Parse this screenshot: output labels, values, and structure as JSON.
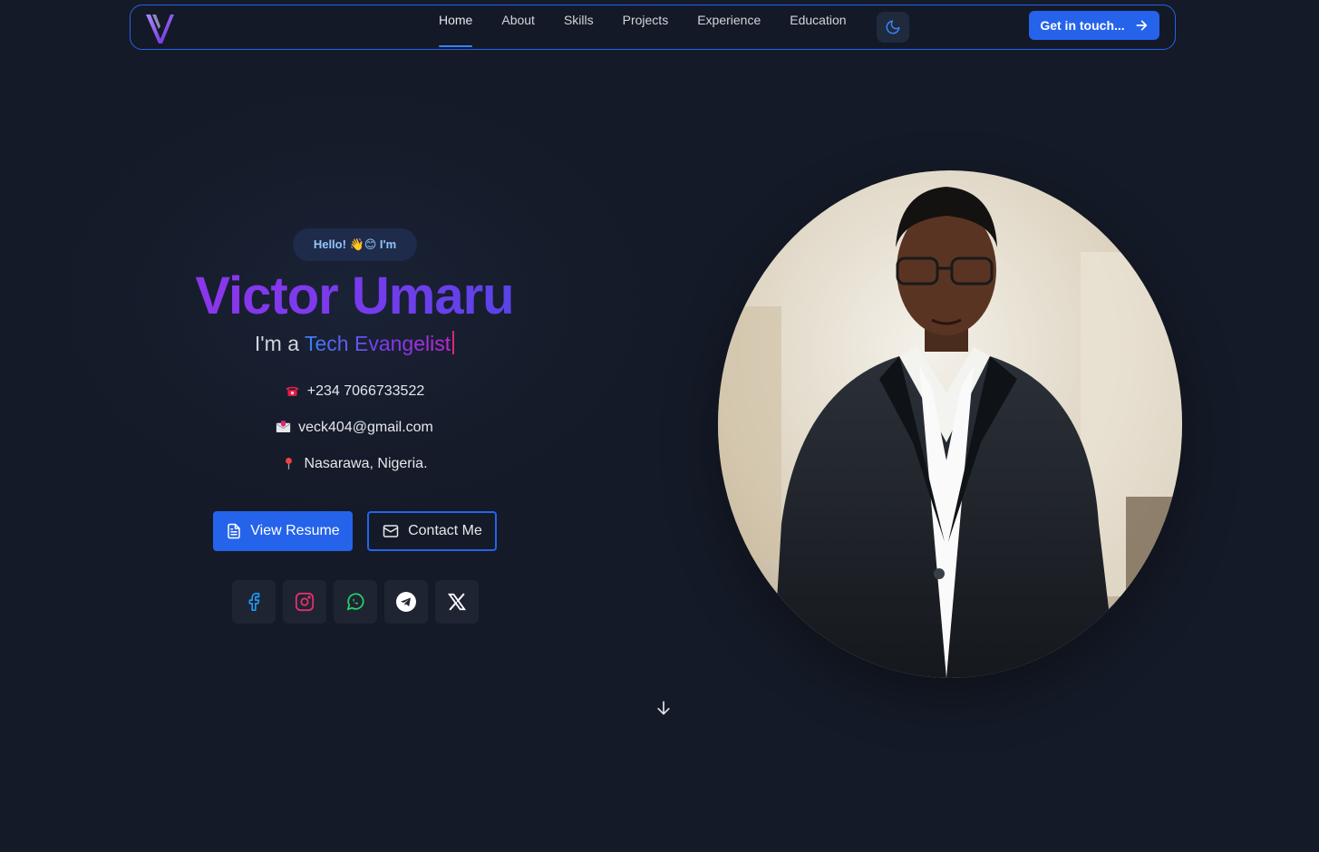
{
  "nav": {
    "links": [
      "Home",
      "About",
      "Skills",
      "Projects",
      "Experience",
      "Education"
    ],
    "active": "Home",
    "cta_label": "Get in touch..."
  },
  "hero": {
    "greeting": "Hello! 👋😊 I'm",
    "name": "Victor Umaru",
    "role_prefix": "I'm a",
    "role_highlight": "Tech Evangelist",
    "phone": "+234 7066733522",
    "email": "veck404@gmail.com",
    "location": "Nasarawa, Nigeria.",
    "resume_label": "View Resume",
    "contact_label": "Contact Me"
  },
  "socials": [
    "facebook-icon",
    "instagram-icon",
    "whatsapp-icon",
    "telegram-icon",
    "x-icon"
  ],
  "colors": {
    "accent": "#2563eb",
    "background": "#141a28",
    "name_gradient": [
      "#9333ea",
      "#4f46e5"
    ]
  }
}
